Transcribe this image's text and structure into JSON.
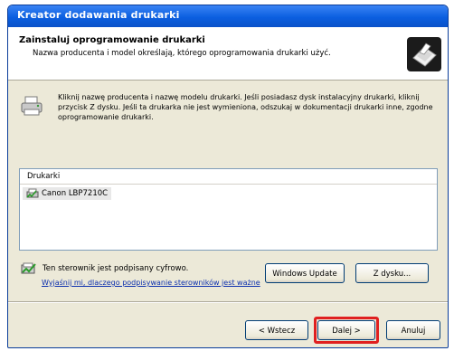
{
  "window": {
    "title": "Kreator dodawania drukarki"
  },
  "header": {
    "title": "Zainstaluj oprogramowanie drukarki",
    "subtitle": "Nazwa producenta i model określają, którego oprogramowania drukarki użyć."
  },
  "intro_text": "Kliknij nazwę producenta i nazwę modelu drukarki. Jeśli posiadasz dysk instalacyjny drukarki, kliknij przycisk Z dysku. Jeśli ta drukarka nie jest wymieniona, odszukaj w dokumentacji drukarki inne, zgodne oprogramowanie drukarki.",
  "printer_list": {
    "header": "Drukarki",
    "items": [
      {
        "label": "Canon LBP7210C",
        "selected": true
      }
    ]
  },
  "signature": {
    "text": "Ten sterownik jest podpisany cyfrowo.",
    "link": "Wyjaśnij mi, dlaczego podpisywanie sterowników jest ważne"
  },
  "buttons": {
    "windows_update": "Windows Update",
    "have_disk": "Z dysku...",
    "back": "< Wstecz",
    "next": "Dalej >",
    "cancel": "Anuluj"
  },
  "colors": {
    "titlebar": "#0b5fe0",
    "highlight": "#e02020",
    "link": "#0b2fae"
  },
  "icons": [
    "printer-install-icon",
    "printer-icon",
    "printer-list-icon",
    "signature-icon"
  ]
}
